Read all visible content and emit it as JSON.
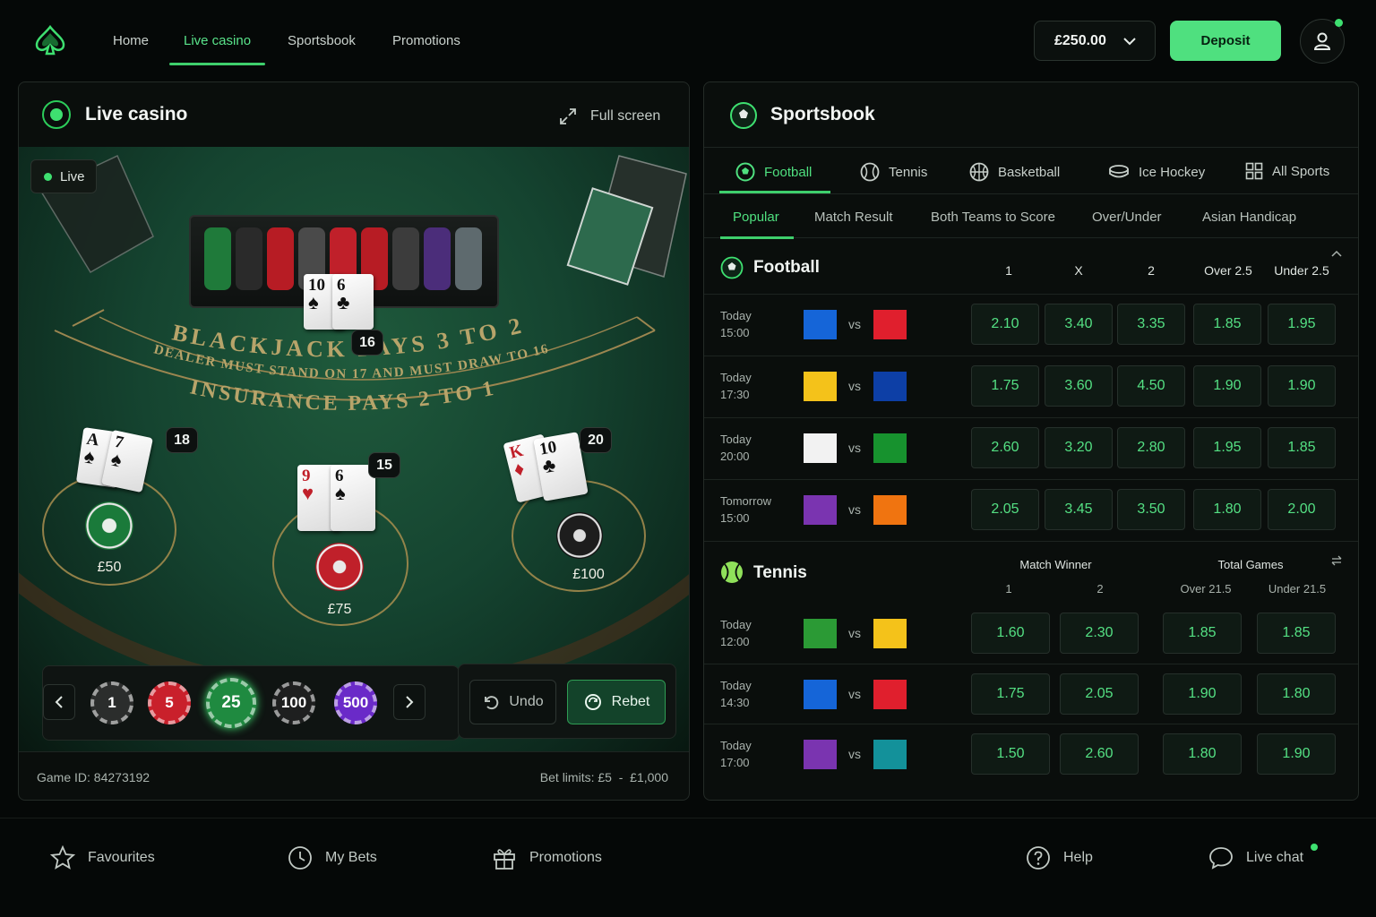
{
  "nav": {
    "items": [
      "Home",
      "Live casino",
      "Sportsbook",
      "Promotions"
    ],
    "active": "Live casino"
  },
  "account": {
    "balance": "£250.00",
    "deposit_label": "Deposit"
  },
  "casino": {
    "title": "Live casino",
    "fullscreen_label": "Full screen",
    "live_badge": "Live",
    "felt_text_1": "BLACKJACK PAYS 3 TO 2",
    "felt_text_2": "DEALER MUST STAND ON 17 AND MUST DRAW TO 16",
    "felt_text_3": "INSURANCE PAYS 2 TO 1",
    "dealer": {
      "cards": [
        "10",
        "6"
      ],
      "score": "16"
    },
    "players": [
      {
        "cards": [
          "A",
          "7"
        ],
        "score": "18",
        "bet": "£50"
      },
      {
        "cards": [
          "9",
          "6"
        ],
        "score": "15",
        "bet": "£75"
      },
      {
        "cards": [
          "K",
          "10"
        ],
        "score": "20",
        "bet": "£100"
      }
    ],
    "chips": [
      "1",
      "5",
      "25",
      "100",
      "500"
    ],
    "selected_chip": "25",
    "undo_label": "Undo",
    "rebet_label": "Rebet",
    "game_id_label": "Game ID:",
    "game_id": "84273192",
    "bet_limits_label": "Bet limits:",
    "bet_limits": "£5  -  £1,000"
  },
  "sports": {
    "title": "Sportsbook",
    "tabs": [
      "Football",
      "Tennis",
      "Basketball",
      "Ice Hockey",
      "All Sports"
    ],
    "active_tab": "Football",
    "market_tabs": [
      "Popular",
      "Match Result",
      "Both Teams to Score",
      "Over/Under",
      "Asian Handicap"
    ],
    "active_market": "Popular",
    "football": {
      "name": "Football",
      "columns": [
        "1",
        "X",
        "2",
        "Over 2.5",
        "Under 2.5"
      ],
      "matches": [
        {
          "day": "Today",
          "time": "15:00",
          "home_color": "#1565d8",
          "away_color": "#e01f2d",
          "odds": [
            "2.10",
            "3.40",
            "3.35",
            "1.85",
            "1.95"
          ]
        },
        {
          "day": "Today",
          "time": "17:30",
          "home_color": "#f4c21a",
          "away_color": "#0d3fa6",
          "odds": [
            "1.75",
            "3.60",
            "4.50",
            "1.90",
            "1.90"
          ]
        },
        {
          "day": "Today",
          "time": "20:00",
          "home_color": "#f2f2f2",
          "away_color": "#17922e",
          "odds": [
            "2.60",
            "3.20",
            "2.80",
            "1.95",
            "1.85"
          ]
        },
        {
          "day": "Tomorrow",
          "time": "15:00",
          "home_color": "#7a34b0",
          "away_color": "#f07410",
          "odds": [
            "2.05",
            "3.45",
            "3.50",
            "1.80",
            "2.00"
          ]
        }
      ]
    },
    "tennis": {
      "name": "Tennis",
      "group_1": "Match Winner",
      "group_2": "Total Games",
      "columns": [
        "1",
        "2",
        "Over 21.5",
        "Under 21.5"
      ],
      "matches": [
        {
          "day": "Today",
          "time": "12:00",
          "home_color": "#2b9a35",
          "away_color": "#f4c21a",
          "odds": [
            "1.60",
            "2.30",
            "1.85",
            "1.85"
          ]
        },
        {
          "day": "Today",
          "time": "14:30",
          "home_color": "#1565d8",
          "away_color": "#e01f2d",
          "odds": [
            "1.75",
            "2.05",
            "1.90",
            "1.80"
          ]
        },
        {
          "day": "Today",
          "time": "17:00",
          "home_color": "#7a34b0",
          "away_color": "#13919a",
          "odds": [
            "1.50",
            "2.60",
            "1.80",
            "1.90"
          ]
        }
      ]
    },
    "vs_label": "vs"
  },
  "footer": {
    "items": [
      "Favourites",
      "My Bets",
      "Promotions",
      "Help",
      "Live chat"
    ]
  },
  "colors": {
    "accent": "#4fe07f",
    "background": "#050807",
    "felt": "#1a4d35"
  }
}
